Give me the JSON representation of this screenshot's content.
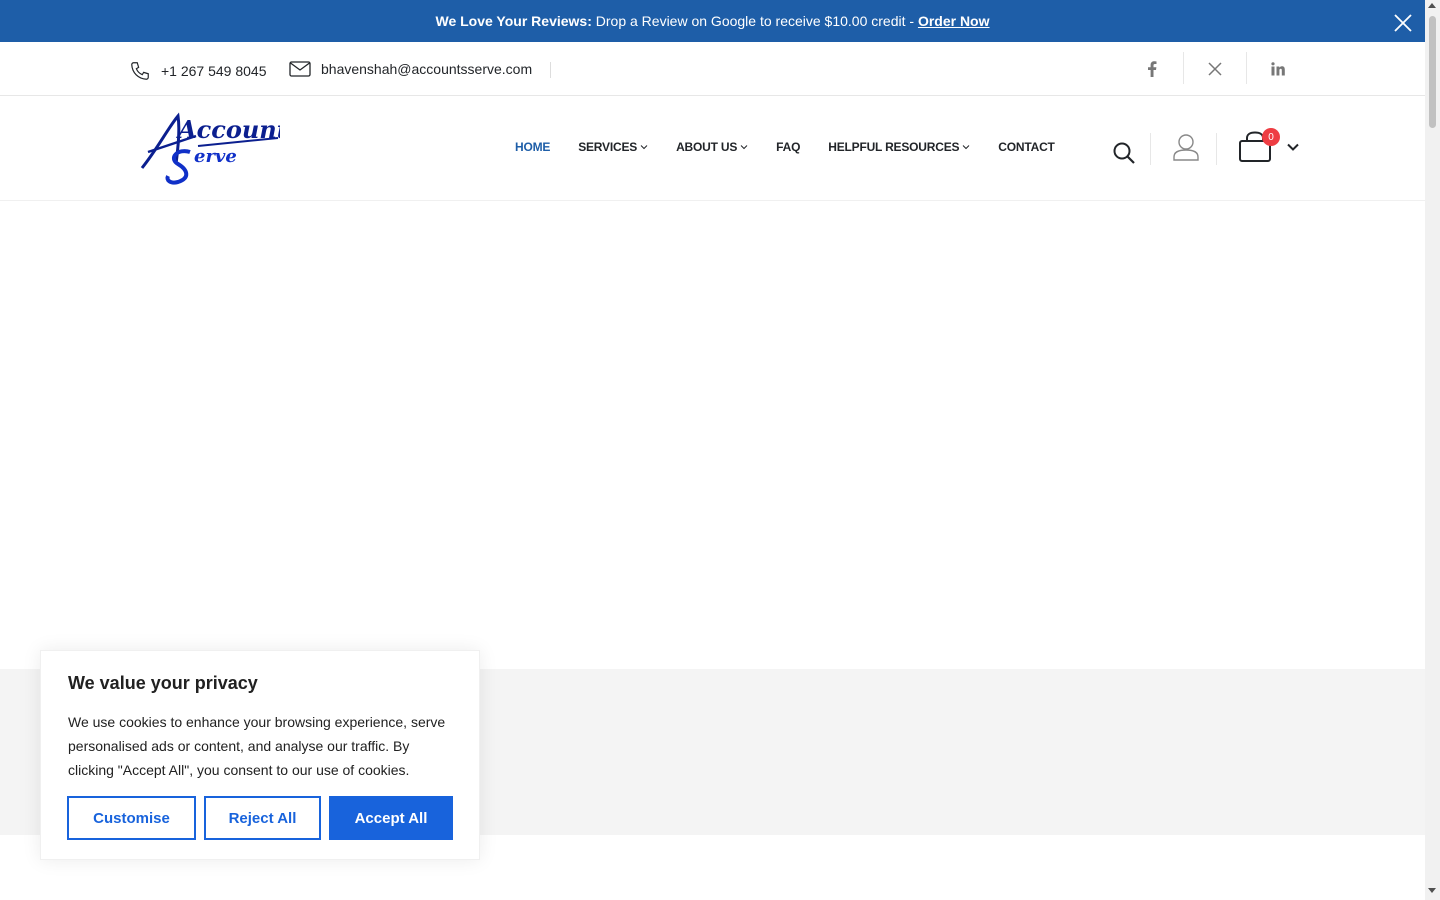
{
  "promo": {
    "bold_text": "We Love Your Reviews:",
    "text": " Drop a Review on Google to receive $10.00 credit - ",
    "link": "Order Now"
  },
  "contact": {
    "phone": "+1 267 549 8045",
    "email": "bhavenshah@accountsserve.com"
  },
  "logo": {
    "line1": "Accounts",
    "line2": "erve",
    "initial": "S"
  },
  "nav": {
    "items": [
      {
        "label": "HOME",
        "active": true,
        "dropdown": false
      },
      {
        "label": "SERVICES",
        "dropdown": true
      },
      {
        "label": "ABOUT US",
        "dropdown": true
      },
      {
        "label": "FAQ",
        "dropdown": false
      },
      {
        "label": "HELPFUL RESOURCES",
        "dropdown": true
      },
      {
        "label": "CONTACT",
        "dropdown": false
      }
    ]
  },
  "cart": {
    "count": "0"
  },
  "cookie": {
    "title": "We value your privacy",
    "body": "We use cookies to enhance your browsing experience, serve personalised ads or content, and analyse our traffic. By clicking \"Accept All\", you consent to our use of cookies.",
    "customise": "Customise",
    "reject": "Reject All",
    "accept": "Accept All"
  },
  "colors": {
    "brand_blue": "#1e5ea8",
    "cookie_blue": "#1863dc",
    "badge_red": "#ee3d43"
  }
}
